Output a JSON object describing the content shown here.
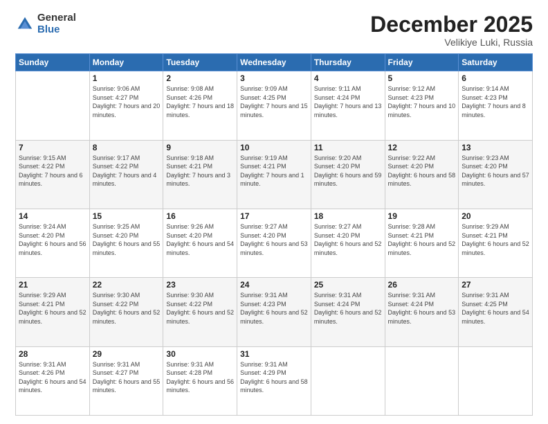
{
  "logo": {
    "general": "General",
    "blue": "Blue"
  },
  "header": {
    "month": "December 2025",
    "location": "Velikiye Luki, Russia"
  },
  "weekdays": [
    "Sunday",
    "Monday",
    "Tuesday",
    "Wednesday",
    "Thursday",
    "Friday",
    "Saturday"
  ],
  "weeks": [
    [
      {
        "day": "",
        "sunrise": "",
        "sunset": "",
        "daylight": ""
      },
      {
        "day": "1",
        "sunrise": "Sunrise: 9:06 AM",
        "sunset": "Sunset: 4:27 PM",
        "daylight": "Daylight: 7 hours and 20 minutes."
      },
      {
        "day": "2",
        "sunrise": "Sunrise: 9:08 AM",
        "sunset": "Sunset: 4:26 PM",
        "daylight": "Daylight: 7 hours and 18 minutes."
      },
      {
        "day": "3",
        "sunrise": "Sunrise: 9:09 AM",
        "sunset": "Sunset: 4:25 PM",
        "daylight": "Daylight: 7 hours and 15 minutes."
      },
      {
        "day": "4",
        "sunrise": "Sunrise: 9:11 AM",
        "sunset": "Sunset: 4:24 PM",
        "daylight": "Daylight: 7 hours and 13 minutes."
      },
      {
        "day": "5",
        "sunrise": "Sunrise: 9:12 AM",
        "sunset": "Sunset: 4:23 PM",
        "daylight": "Daylight: 7 hours and 10 minutes."
      },
      {
        "day": "6",
        "sunrise": "Sunrise: 9:14 AM",
        "sunset": "Sunset: 4:23 PM",
        "daylight": "Daylight: 7 hours and 8 minutes."
      }
    ],
    [
      {
        "day": "7",
        "sunrise": "Sunrise: 9:15 AM",
        "sunset": "Sunset: 4:22 PM",
        "daylight": "Daylight: 7 hours and 6 minutes."
      },
      {
        "day": "8",
        "sunrise": "Sunrise: 9:17 AM",
        "sunset": "Sunset: 4:22 PM",
        "daylight": "Daylight: 7 hours and 4 minutes."
      },
      {
        "day": "9",
        "sunrise": "Sunrise: 9:18 AM",
        "sunset": "Sunset: 4:21 PM",
        "daylight": "Daylight: 7 hours and 3 minutes."
      },
      {
        "day": "10",
        "sunrise": "Sunrise: 9:19 AM",
        "sunset": "Sunset: 4:21 PM",
        "daylight": "Daylight: 7 hours and 1 minute."
      },
      {
        "day": "11",
        "sunrise": "Sunrise: 9:20 AM",
        "sunset": "Sunset: 4:20 PM",
        "daylight": "Daylight: 6 hours and 59 minutes."
      },
      {
        "day": "12",
        "sunrise": "Sunrise: 9:22 AM",
        "sunset": "Sunset: 4:20 PM",
        "daylight": "Daylight: 6 hours and 58 minutes."
      },
      {
        "day": "13",
        "sunrise": "Sunrise: 9:23 AM",
        "sunset": "Sunset: 4:20 PM",
        "daylight": "Daylight: 6 hours and 57 minutes."
      }
    ],
    [
      {
        "day": "14",
        "sunrise": "Sunrise: 9:24 AM",
        "sunset": "Sunset: 4:20 PM",
        "daylight": "Daylight: 6 hours and 56 minutes."
      },
      {
        "day": "15",
        "sunrise": "Sunrise: 9:25 AM",
        "sunset": "Sunset: 4:20 PM",
        "daylight": "Daylight: 6 hours and 55 minutes."
      },
      {
        "day": "16",
        "sunrise": "Sunrise: 9:26 AM",
        "sunset": "Sunset: 4:20 PM",
        "daylight": "Daylight: 6 hours and 54 minutes."
      },
      {
        "day": "17",
        "sunrise": "Sunrise: 9:27 AM",
        "sunset": "Sunset: 4:20 PM",
        "daylight": "Daylight: 6 hours and 53 minutes."
      },
      {
        "day": "18",
        "sunrise": "Sunrise: 9:27 AM",
        "sunset": "Sunset: 4:20 PM",
        "daylight": "Daylight: 6 hours and 52 minutes."
      },
      {
        "day": "19",
        "sunrise": "Sunrise: 9:28 AM",
        "sunset": "Sunset: 4:21 PM",
        "daylight": "Daylight: 6 hours and 52 minutes."
      },
      {
        "day": "20",
        "sunrise": "Sunrise: 9:29 AM",
        "sunset": "Sunset: 4:21 PM",
        "daylight": "Daylight: 6 hours and 52 minutes."
      }
    ],
    [
      {
        "day": "21",
        "sunrise": "Sunrise: 9:29 AM",
        "sunset": "Sunset: 4:21 PM",
        "daylight": "Daylight: 6 hours and 52 minutes."
      },
      {
        "day": "22",
        "sunrise": "Sunrise: 9:30 AM",
        "sunset": "Sunset: 4:22 PM",
        "daylight": "Daylight: 6 hours and 52 minutes."
      },
      {
        "day": "23",
        "sunrise": "Sunrise: 9:30 AM",
        "sunset": "Sunset: 4:22 PM",
        "daylight": "Daylight: 6 hours and 52 minutes."
      },
      {
        "day": "24",
        "sunrise": "Sunrise: 9:31 AM",
        "sunset": "Sunset: 4:23 PM",
        "daylight": "Daylight: 6 hours and 52 minutes."
      },
      {
        "day": "25",
        "sunrise": "Sunrise: 9:31 AM",
        "sunset": "Sunset: 4:24 PM",
        "daylight": "Daylight: 6 hours and 52 minutes."
      },
      {
        "day": "26",
        "sunrise": "Sunrise: 9:31 AM",
        "sunset": "Sunset: 4:24 PM",
        "daylight": "Daylight: 6 hours and 53 minutes."
      },
      {
        "day": "27",
        "sunrise": "Sunrise: 9:31 AM",
        "sunset": "Sunset: 4:25 PM",
        "daylight": "Daylight: 6 hours and 54 minutes."
      }
    ],
    [
      {
        "day": "28",
        "sunrise": "Sunrise: 9:31 AM",
        "sunset": "Sunset: 4:26 PM",
        "daylight": "Daylight: 6 hours and 54 minutes."
      },
      {
        "day": "29",
        "sunrise": "Sunrise: 9:31 AM",
        "sunset": "Sunset: 4:27 PM",
        "daylight": "Daylight: 6 hours and 55 minutes."
      },
      {
        "day": "30",
        "sunrise": "Sunrise: 9:31 AM",
        "sunset": "Sunset: 4:28 PM",
        "daylight": "Daylight: 6 hours and 56 minutes."
      },
      {
        "day": "31",
        "sunrise": "Sunrise: 9:31 AM",
        "sunset": "Sunset: 4:29 PM",
        "daylight": "Daylight: 6 hours and 58 minutes."
      },
      {
        "day": "",
        "sunrise": "",
        "sunset": "",
        "daylight": ""
      },
      {
        "day": "",
        "sunrise": "",
        "sunset": "",
        "daylight": ""
      },
      {
        "day": "",
        "sunrise": "",
        "sunset": "",
        "daylight": ""
      }
    ]
  ]
}
